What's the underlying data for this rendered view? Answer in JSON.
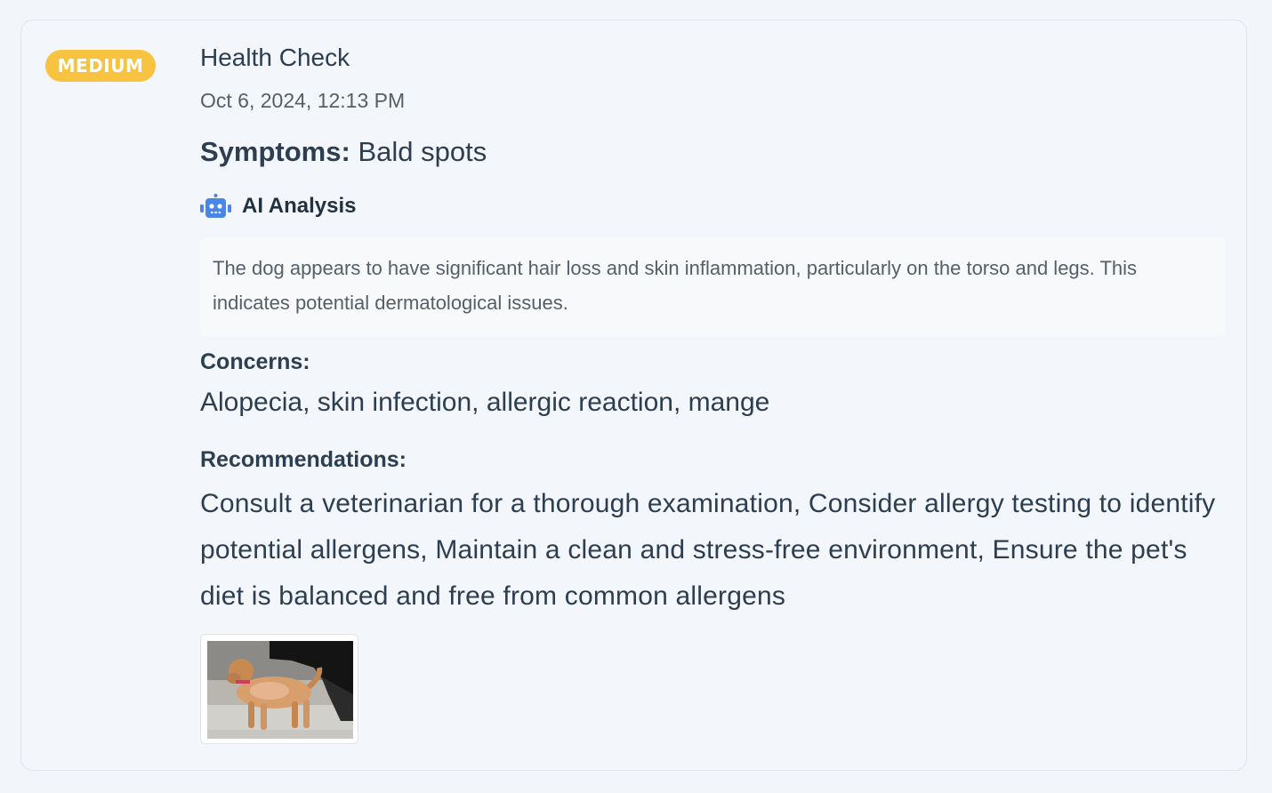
{
  "entry": {
    "severity": "MEDIUM",
    "title": "Health Check",
    "date": "Oct 6, 2024, 12:13 PM",
    "symptoms_label": "Symptoms:",
    "symptoms_value": "Bald spots",
    "ai_analysis_title": "AI Analysis",
    "ai_analysis_text": "The dog appears to have significant hair loss and skin inflammation, particularly on the torso and legs. This indicates potential dermatological issues.",
    "concerns_label": "Concerns:",
    "concerns_value": "Alopecia, skin infection, allergic reaction, mange",
    "recommendations_label": "Recommendations:",
    "recommendations_value": "Consult a veterinarian for a thorough examination, Consider allergy testing to identify potential allergens, Maintain a clean and stress-free environment, Ensure the pet's diet is balanced and free from common allergens",
    "image_icon": "dog-photo-thumbnail"
  },
  "colors": {
    "badge": "#f8c341",
    "robot_icon": "#4a86e8",
    "text": "#2c3e50",
    "muted": "#555f6a"
  }
}
